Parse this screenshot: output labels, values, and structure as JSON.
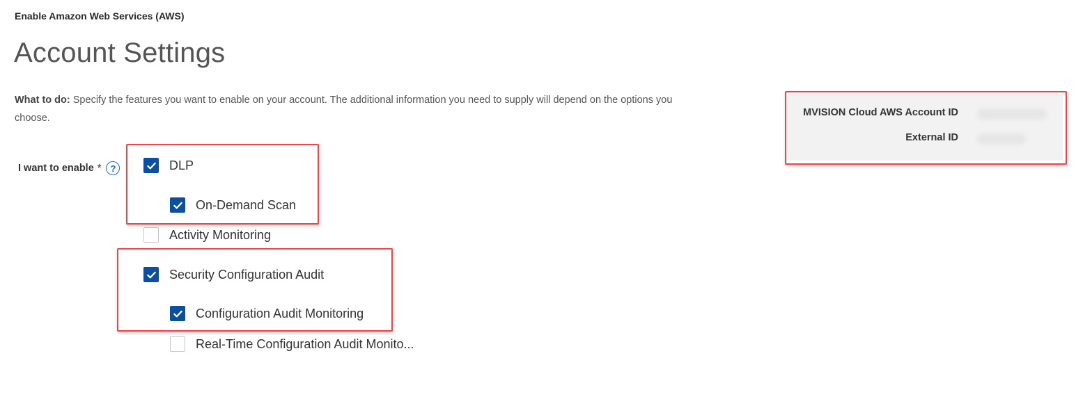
{
  "breadcrumb": "Enable Amazon Web Services (AWS)",
  "page_title": "Account Settings",
  "instructions": {
    "lead": "What to do:",
    "text": " Specify the features you want to enable on your account. The additional information you need to supply will depend on the options you choose."
  },
  "field": {
    "label": "I want to enable",
    "required_mark": "*",
    "help_glyph": "?"
  },
  "options": {
    "dlp": {
      "label": "DLP",
      "checked": true
    },
    "on_demand_scan": {
      "label": "On-Demand Scan",
      "checked": true
    },
    "activity_monitoring": {
      "label": "Activity Monitoring",
      "checked": false
    },
    "security_config_audit": {
      "label": "Security Configuration Audit",
      "checked": true
    },
    "config_audit_monitoring": {
      "label": "Configuration Audit Monitoring",
      "checked": true
    },
    "realtime_config_audit": {
      "label": "Real-Time Configuration Audit Monito...",
      "checked": false
    }
  },
  "info_box": {
    "account_id_label": "MVISION Cloud AWS Account ID",
    "external_id_label": "External ID"
  },
  "colors": {
    "checkbox_checked": "#0b4fa3",
    "highlight_border": "#e8484d",
    "help_icon": "#1f6bd1",
    "required_mark": "#d8323c",
    "info_box_bg": "#f2f2f2"
  },
  "icons": {
    "checkmark": "check-icon",
    "help": "help-circle-icon"
  }
}
